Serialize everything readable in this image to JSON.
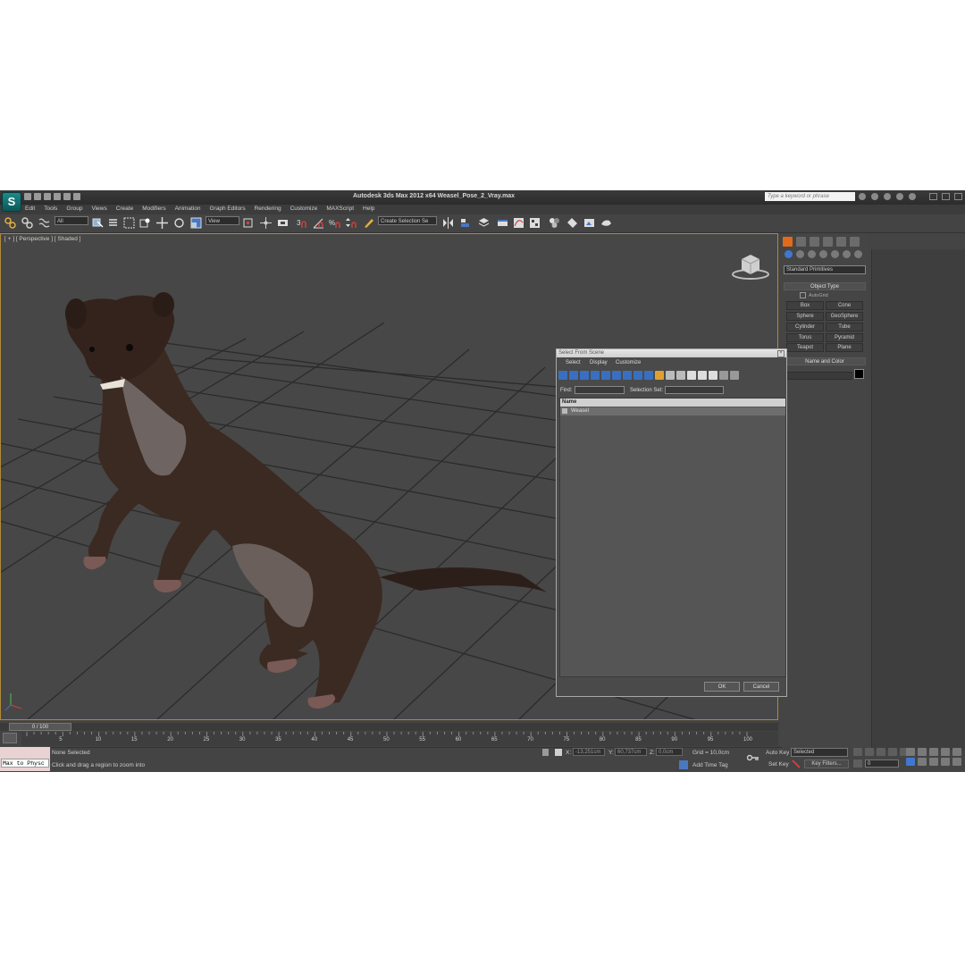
{
  "titlebar": {
    "title": "Autodesk 3ds Max  2012 x64      Weasel_Pose_2_Vray.max",
    "search_placeholder": "Type a keyword or phrase"
  },
  "menu": [
    "Edit",
    "Tools",
    "Group",
    "Views",
    "Create",
    "Modifiers",
    "Animation",
    "Graph Editors",
    "Rendering",
    "Customize",
    "MAXScript",
    "Help"
  ],
  "toolbar": {
    "selection_filter": "All",
    "ref_coord": "View",
    "selection_set": "Create Selection Se"
  },
  "viewport": {
    "label": "[ + ] [ Perspective ] [ Shaded ]",
    "model_fur_color": "#3b2a22",
    "model_belly_color": "#6e6461"
  },
  "command_panel": {
    "category": "Standard Primitives",
    "object_type_title": "Object Type",
    "autogrid_label": "AutoGrid",
    "primitives": [
      "Box",
      "Cone",
      "Sphere",
      "GeoSphere",
      "Cylinder",
      "Tube",
      "Torus",
      "Pyramid",
      "Teapot",
      "Plane"
    ],
    "name_color_title": "Name and Color"
  },
  "dialog": {
    "title": "Select From Scene",
    "menu": [
      "Select",
      "Display",
      "Customize"
    ],
    "find_label": "Find:",
    "selection_set_label": "Selection Set:",
    "list_header": "Name",
    "items": [
      "Weasel"
    ],
    "ok_label": "OK",
    "cancel_label": "Cancel"
  },
  "timeline": {
    "slider_text": "0 / 100",
    "ticks": [
      "0",
      "5",
      "10",
      "15",
      "20",
      "25",
      "30",
      "35",
      "40",
      "45",
      "50",
      "55",
      "60",
      "65",
      "70",
      "75",
      "80",
      "85",
      "90",
      "95",
      "100"
    ]
  },
  "status": {
    "maxscript_text": "Max to Physc",
    "selection": "None Selected",
    "prompt": "Click and drag a region to zoom into",
    "x_label": "X:",
    "x_value": "-13,251cm",
    "y_label": "Y:",
    "y_value": "60,737cm",
    "z_label": "Z:",
    "z_value": "0,0cm",
    "grid": "Grid = 10,0cm",
    "add_time_tag": "Add Time Tag",
    "auto_key": "Auto Key",
    "set_key": "Set Key",
    "selected_option": "Selected",
    "key_filters": "Key Filters...",
    "current_frame": "0"
  }
}
